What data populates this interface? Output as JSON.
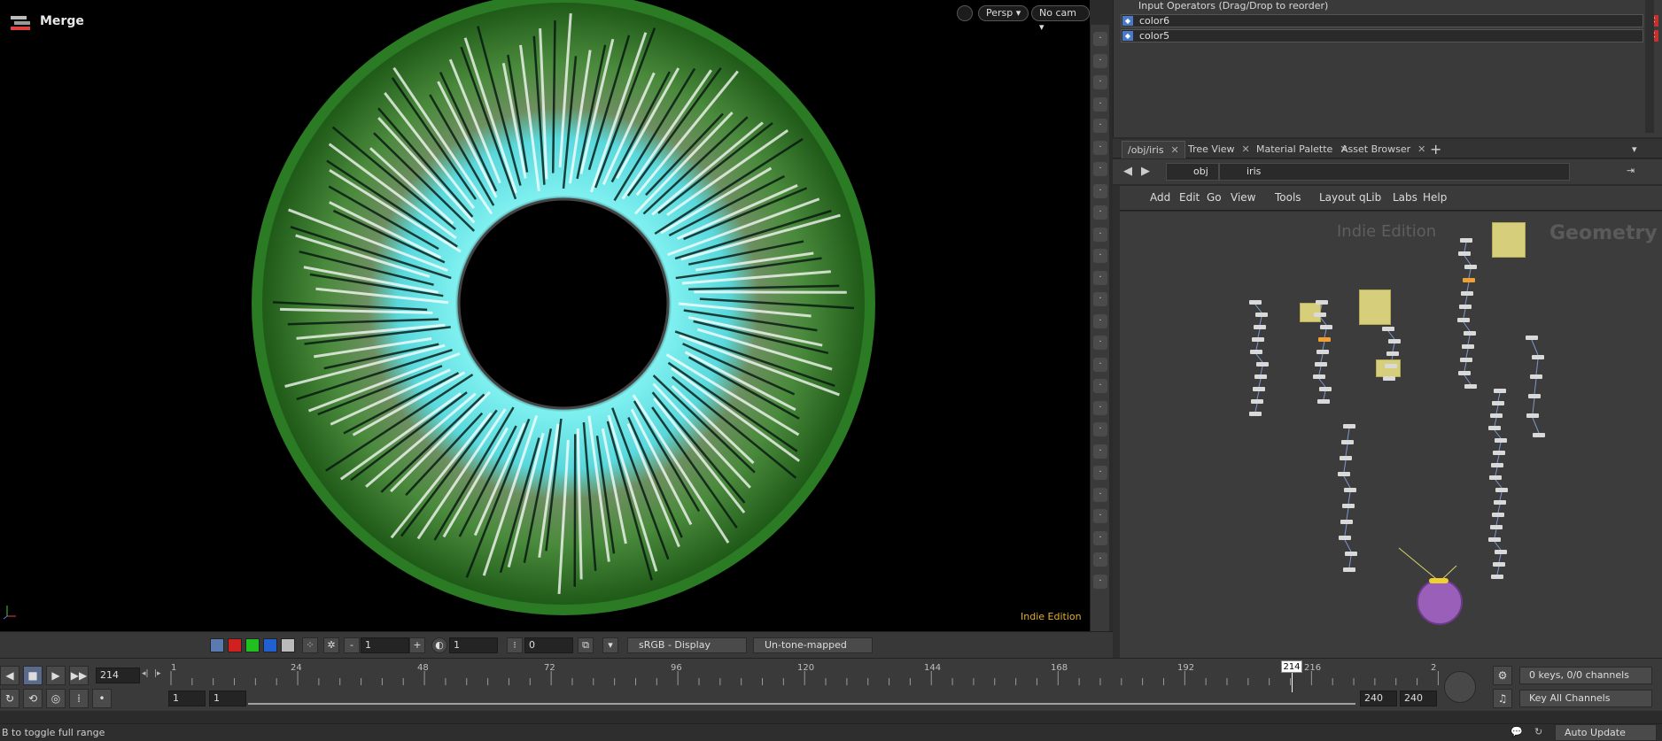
{
  "viewport": {
    "title": "Merge",
    "camera_view": "Persp",
    "camera": "No cam",
    "watermark": "Indie Edition",
    "shelf_icons": [
      "view-icon",
      "render-icon",
      "lock-icon",
      "ghost-icon",
      "sphere-icon",
      "snap-icon",
      "light-icon",
      "camera-icon",
      "transform-icon",
      "move-icon",
      "point-icon",
      "brush-icon",
      "paint-icon",
      "number-icon",
      "wand-icon",
      "number2-icon",
      "corner-icon",
      "pen-icon",
      "grid-icon",
      "shape-icon",
      "texture-icon",
      "tool-icon",
      "box-icon",
      "screen-icon",
      "bulb-icon",
      "info-icon"
    ],
    "shelf_labels": [
      "12",
      "12"
    ]
  },
  "display_bar": {
    "step_value": "1",
    "field2": "1",
    "field3": "0",
    "colorspace": "sRGB - Display",
    "tonemap": "Un-tone-mapped",
    "minus": "-",
    "plus": "+"
  },
  "inputs": {
    "header": "Input Operators (Drag/Drop to reorder)",
    "items": [
      {
        "name": "color6"
      },
      {
        "name": "color5"
      }
    ]
  },
  "network": {
    "tabs": [
      {
        "label": "/obj/iris",
        "active": true
      },
      {
        "label": "Tree View",
        "active": false
      },
      {
        "label": "Material Palette",
        "active": false
      },
      {
        "label": "Asset Browser",
        "active": false
      }
    ],
    "path": [
      "obj",
      "iris"
    ],
    "menu": [
      "Add",
      "Edit",
      "Go",
      "View",
      "Tools",
      "Layout",
      "qLib",
      "Labs",
      "Help"
    ],
    "watermark": "Indie Edition",
    "context_label": "Geometry"
  },
  "timeline": {
    "current_frame": "214",
    "frame_marker": "214",
    "ticks": [
      "1",
      "24",
      "48",
      "72",
      "96",
      "120",
      "144",
      "168",
      "192",
      "216",
      "2"
    ],
    "start_frame": "1",
    "start_frame2": "1",
    "end_frame": "240",
    "end_frame2": "240",
    "keys_info": "0 keys, 0/0 channels",
    "key_all": "Key All Channels",
    "auto_update": "Auto Update"
  },
  "status": {
    "text": "B to toggle full range"
  },
  "colors": {
    "accent_orange": "#f0a030",
    "remove_red": "#c83030",
    "watermark_yellow": "#e0b030"
  }
}
